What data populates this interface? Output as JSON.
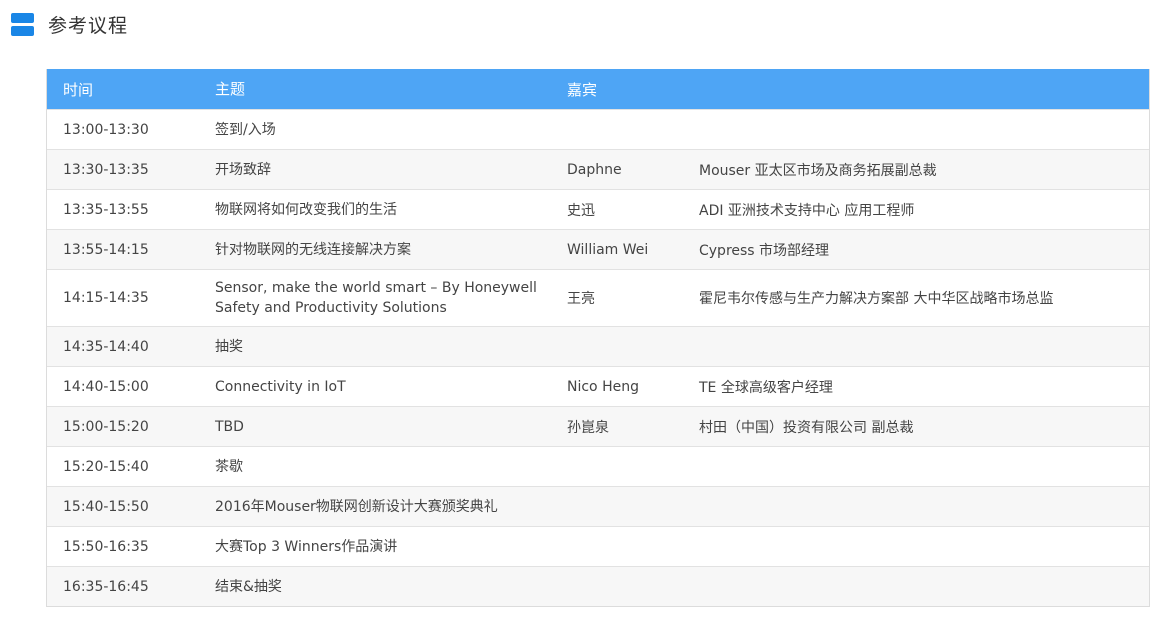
{
  "section": {
    "title": "参考议程"
  },
  "colors": {
    "header_bg": "#4ea5f5",
    "icon": "#1a86e6"
  },
  "table": {
    "headers": {
      "time": "时间",
      "topic": "主题",
      "speaker": "嘉宾"
    },
    "rows": [
      {
        "time": "13:00-13:30",
        "topic": "签到/入场",
        "speaker": "",
        "speaker_title": ""
      },
      {
        "time": "13:30-13:35",
        "topic": "开场致辞",
        "speaker": "Daphne",
        "speaker_title": "Mouser 亚太区市场及商务拓展副总裁"
      },
      {
        "time": "13:35-13:55",
        "topic": "物联网将如何改变我们的生活",
        "speaker": "史迅",
        "speaker_title": "ADI 亚洲技术支持中心 应用工程师"
      },
      {
        "time": "13:55-14:15",
        "topic": "针对物联网的无线连接解决方案",
        "speaker": "William Wei",
        "speaker_title": "Cypress 市场部经理"
      },
      {
        "time": "14:15-14:35",
        "topic": "Sensor, make the world smart – By Honeywell Safety and Productivity Solutions",
        "speaker": "王亮",
        "speaker_title": "霍尼韦尔传感与生产力解决方案部 大中华区战略市场总监"
      },
      {
        "time": "14:35-14:40",
        "topic": "抽奖",
        "speaker": "",
        "speaker_title": ""
      },
      {
        "time": "14:40-15:00",
        "topic": "Connectivity in IoT",
        "speaker": "Nico Heng",
        "speaker_title": "TE 全球高级客户经理"
      },
      {
        "time": "15:00-15:20",
        "topic": "TBD",
        "speaker": "孙崑泉",
        "speaker_title": "村田（中国）投资有限公司 副总裁"
      },
      {
        "time": "15:20-15:40",
        "topic": "茶歇",
        "speaker": "",
        "speaker_title": ""
      },
      {
        "time": "15:40-15:50",
        "topic": "2016年Mouser物联网创新设计大赛颁奖典礼",
        "speaker": "",
        "speaker_title": ""
      },
      {
        "time": "15:50-16:35",
        "topic": "大赛Top 3 Winners作品演讲",
        "speaker": "",
        "speaker_title": ""
      },
      {
        "time": "16:35-16:45",
        "topic": "结束&抽奖",
        "speaker": "",
        "speaker_title": ""
      }
    ]
  }
}
